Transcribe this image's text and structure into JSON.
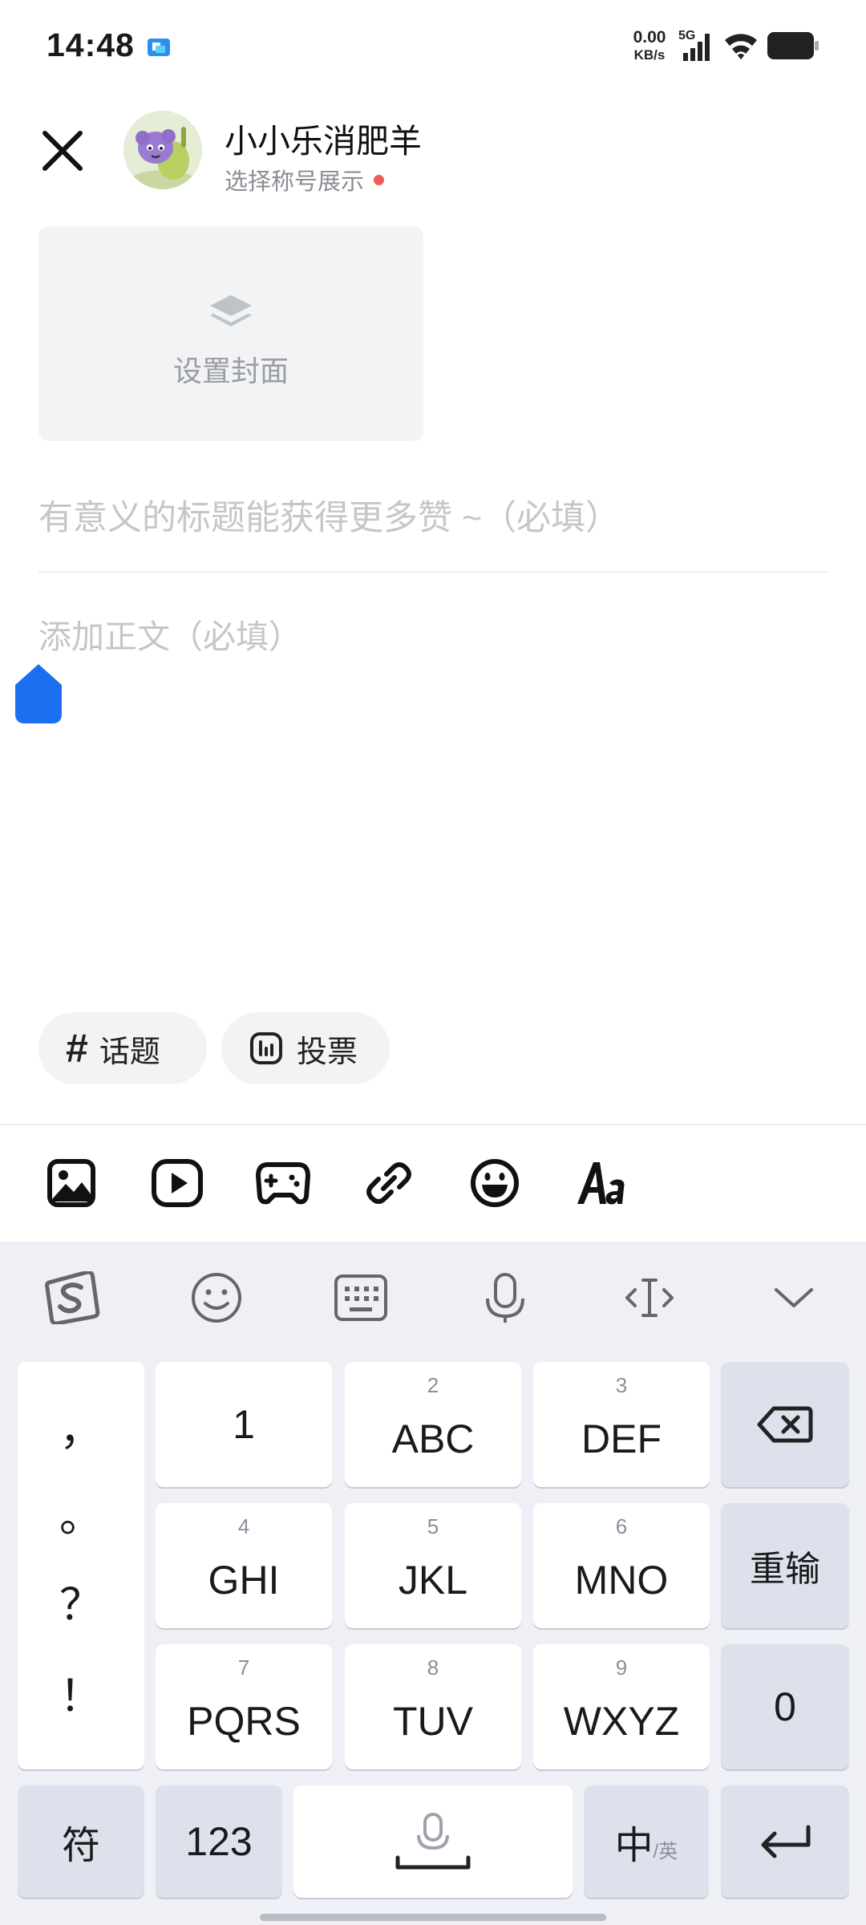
{
  "status_bar": {
    "time": "14:48",
    "net_speed_value": "0.00",
    "net_speed_unit": "KB/s",
    "network_type": "5G"
  },
  "header": {
    "user_name": "小小乐消肥羊",
    "title_select": "选择称号展示"
  },
  "cover": {
    "label": "设置封面"
  },
  "editor": {
    "title_placeholder": "有意义的标题能获得更多赞 ~（必填）",
    "body_placeholder": "添加正文（必填）"
  },
  "chips": {
    "topic_label": "话题",
    "vote_label": "投票"
  },
  "toolbar": {
    "icons": [
      "image-icon",
      "video-icon",
      "game-icon",
      "link-icon",
      "emoji-icon",
      "text-format-icon"
    ]
  },
  "keyboard": {
    "toolbar_icons": [
      "sogou-logo-icon",
      "emoji-face-icon",
      "keyboard-icon",
      "microphone-icon",
      "cursor-move-icon",
      "collapse-icon"
    ],
    "punctuation": [
      "，",
      "。",
      "？",
      "！"
    ],
    "keys": {
      "k1": {
        "main": "1"
      },
      "k2": {
        "num": "2",
        "main": "ABC"
      },
      "k3": {
        "num": "3",
        "main": "DEF"
      },
      "k4": {
        "num": "4",
        "main": "GHI"
      },
      "k5": {
        "num": "5",
        "main": "JKL"
      },
      "k6": {
        "num": "6",
        "main": "MNO"
      },
      "k7": {
        "num": "7",
        "main": "PQRS"
      },
      "k8": {
        "num": "8",
        "main": "TUV"
      },
      "k9": {
        "num": "9",
        "main": "WXYZ"
      }
    },
    "reset_label": "重输",
    "zero_label": "0",
    "symbol_label": "符",
    "num_label": "123",
    "lang_main": "中",
    "lang_alt": "/英"
  }
}
